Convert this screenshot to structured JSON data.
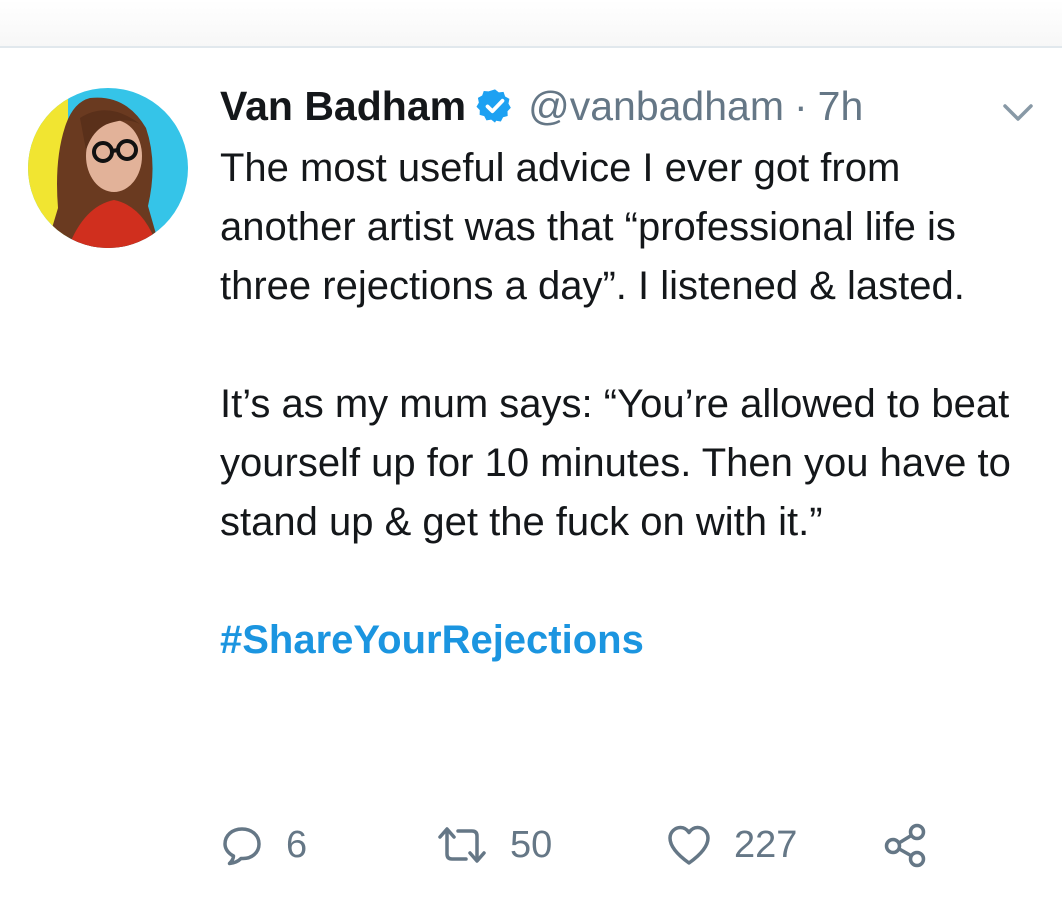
{
  "tweet": {
    "author_name": "Van Badham",
    "handle": "@vanbadham",
    "separator": "·",
    "time": "7h",
    "paragraphs": [
      "The most useful advice I ever got from another artist was that “professional life is three rejections a day”. I listened & lasted.",
      "It’s as my mum says: “You’re allowed to beat yourself up for 10 minutes. Then you have to stand up & get the fuck on with it.”"
    ],
    "hashtag": "#ShareYourRejections"
  },
  "actions": {
    "reply_count": "6",
    "retweet_count": "50",
    "like_count": "227"
  },
  "colors": {
    "text": "#14171a",
    "secondary": "#657786",
    "link": "#1b95e0",
    "verified": "#1da1f2",
    "divider": "#e1e8ed"
  },
  "icons": [
    "verified-badge-icon",
    "chevron-down-icon",
    "reply-icon",
    "retweet-icon",
    "like-icon",
    "share-icon"
  ]
}
